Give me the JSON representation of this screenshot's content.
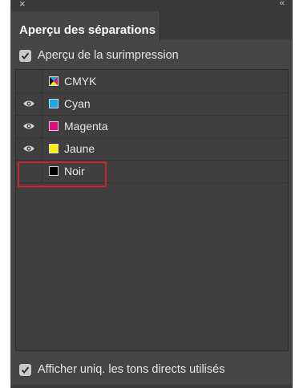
{
  "panel": {
    "tab_label": "Aperçu des séparations",
    "close_glyph": "×",
    "collapse_glyph": "‹‹"
  },
  "overprint": {
    "label": "Aperçu de la surimpression",
    "checked": true
  },
  "separations": [
    {
      "label": "CMYK",
      "visible": false,
      "icon": "cmyk-swatch"
    },
    {
      "label": "Cyan",
      "visible": true,
      "icon": "cyan-swatch",
      "color": "#1aa7e6"
    },
    {
      "label": "Magenta",
      "visible": true,
      "icon": "magenta-swatch",
      "color": "#e4097d"
    },
    {
      "label": "Jaune",
      "visible": true,
      "icon": "yellow-swatch",
      "color": "#fff200"
    },
    {
      "label": "Noir",
      "visible": false,
      "icon": "black-swatch",
      "color": "#000000"
    }
  ],
  "spot_only": {
    "label": "Afficher uniq. les tons directs utilisés",
    "checked": true
  },
  "colors": {
    "highlight": "#d0222c",
    "panel_bg": "#454545"
  }
}
